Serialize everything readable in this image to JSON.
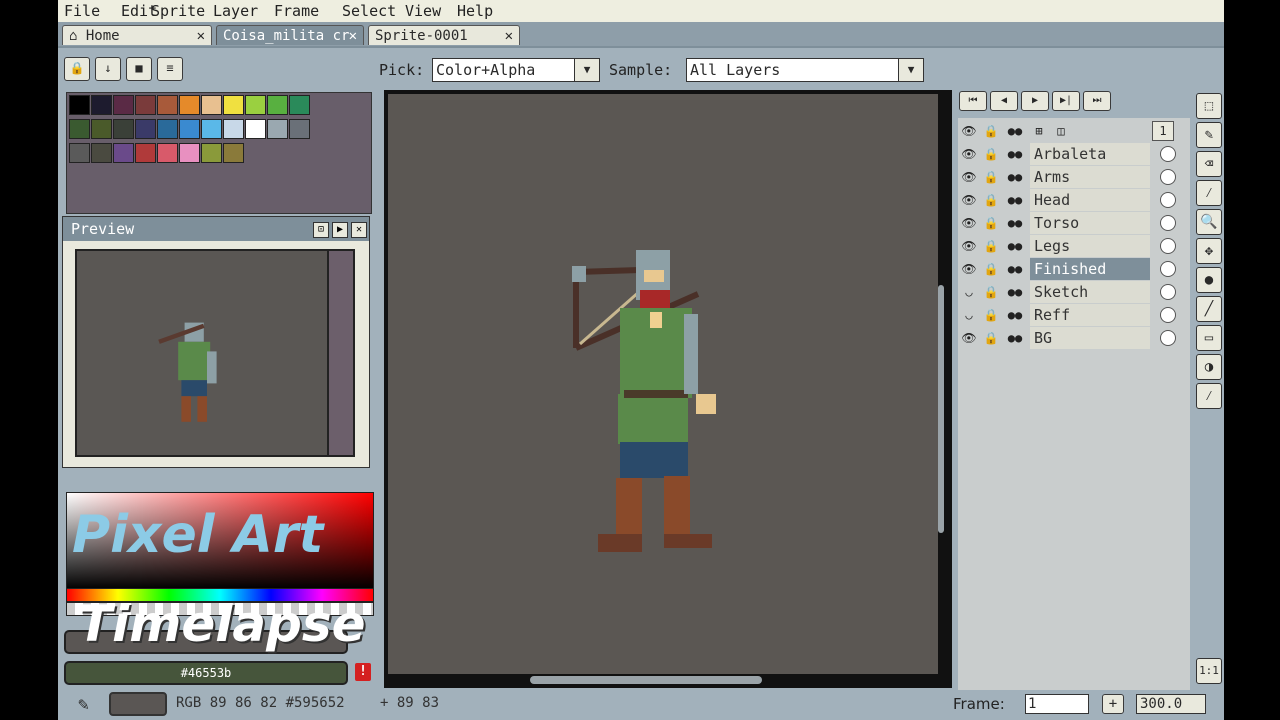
{
  "menu": [
    "File",
    "Edit",
    "Sprite",
    "Layer",
    "Frame",
    "Select",
    "View",
    "Help"
  ],
  "tabs": [
    {
      "label": "Home",
      "icon": "home-icon",
      "close": "✕"
    },
    {
      "label": "Coisa_milita cr",
      "close": "✕"
    },
    {
      "label": "Sprite-0001",
      "close": "✕"
    }
  ],
  "toolbar": {
    "pick_label": "Pick:",
    "pick_value": "Color+Alpha",
    "sample_label": "Sample:",
    "sample_value": "All Layers"
  },
  "preview": {
    "title": "Preview"
  },
  "palette": {
    "colors": [
      "#000000",
      "#1d1b2e",
      "#5a2a45",
      "#7a3b3b",
      "#a85a3a",
      "#e58a2a",
      "#e8c090",
      "#f0e040",
      "#9ad040",
      "#58b040",
      "#2a8a5a",
      "#3a5a30",
      "#4a5a2a",
      "#3a4038",
      "#3a3a68",
      "#2a6a9a",
      "#3a8ad0",
      "#5ab8e8",
      "#c8d8e8",
      "#ffffff",
      "#9aa8b0",
      "#6a7078",
      "#5a5a5a",
      "#4a4a40",
      "#6a4a8a",
      "#b03a3a",
      "#d85a6a",
      "#e890c0",
      "#8a9a3a",
      "#8a7a3a"
    ]
  },
  "overlay": {
    "line1": "Pixel Art",
    "line2": "Timelapse"
  },
  "colors": {
    "fg_hex": "#46553b"
  },
  "status": {
    "readout": "RGB 89 86 82 #595652",
    "pos": "+ 89 83",
    "frame_label": "Frame:",
    "frame_value": "1",
    "zoom": "300.0"
  },
  "layers": {
    "header_frame": "1",
    "items": [
      {
        "name": "Arbaleta",
        "visible": true
      },
      {
        "name": "Arms",
        "visible": true
      },
      {
        "name": "Head",
        "visible": true
      },
      {
        "name": "Torso",
        "visible": true
      },
      {
        "name": "Legs",
        "visible": true
      },
      {
        "name": "Finished",
        "visible": true,
        "selected": true
      },
      {
        "name": "Sketch",
        "visible": false
      },
      {
        "name": "Reff",
        "visible": false
      },
      {
        "name": "BG",
        "visible": true
      }
    ]
  },
  "playback": [
    "⏮",
    "◀",
    "▶",
    "▶|",
    "⏭"
  ],
  "tools": [
    "marquee-icon",
    "pencil-icon",
    "eraser-icon",
    "eyedropper-icon",
    "zoom-icon",
    "move-icon",
    "paint-bucket-icon",
    "line-icon",
    "rectangle-icon",
    "contour-icon",
    "blur-icon"
  ],
  "actual_size_label": "1:1"
}
